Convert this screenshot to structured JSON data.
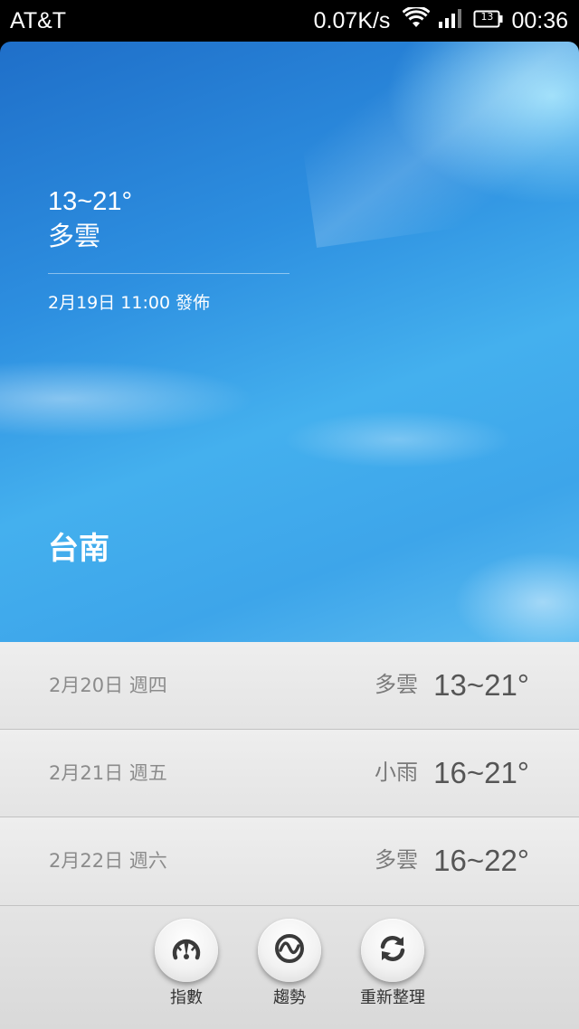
{
  "status_bar": {
    "carrier": "AT&T",
    "network_speed": "0.07K/s",
    "battery_level": "13",
    "time": "00:36"
  },
  "current": {
    "temp_range": "13~21°",
    "condition": "多雲",
    "published": "2月19日 11:00 發佈",
    "city": "台南"
  },
  "forecast": [
    {
      "date": "2月20日 週四",
      "condition": "多雲",
      "temp": "13~21°"
    },
    {
      "date": "2月21日 週五",
      "condition": "小雨",
      "temp": "16~21°"
    },
    {
      "date": "2月22日 週六",
      "condition": "多雲",
      "temp": "16~22°"
    }
  ],
  "toolbar": {
    "index_label": "指數",
    "trend_label": "趨勢",
    "refresh_label": "重新整理"
  },
  "icons": {
    "index": "gauge-icon",
    "trend": "trend-wave-icon",
    "refresh": "refresh-icon"
  },
  "colors": {
    "sky_top": "#1f6fc9",
    "sky_bottom": "#5cbcf0",
    "list_background": "#eeeeee",
    "icon_dark": "#3a3a3a"
  }
}
